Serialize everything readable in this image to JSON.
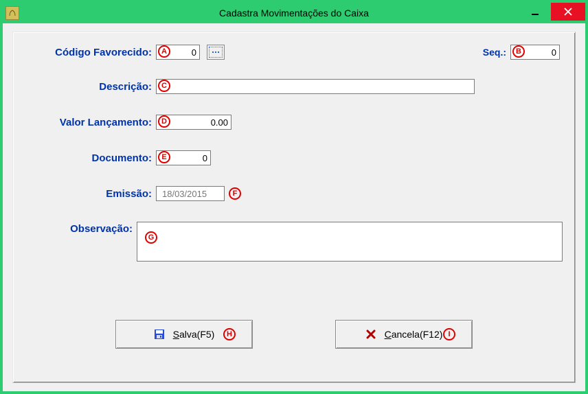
{
  "window": {
    "title": "Cadastra Movimentações do Caixa"
  },
  "labels": {
    "codigo_favorecido": "Código Favorecido:",
    "seq": "Seq.:",
    "descricao": "Descrição:",
    "valor_lancamento": "Valor Lançamento:",
    "documento": "Documento:",
    "emissao": "Emissão:",
    "observacao": "Observação:"
  },
  "values": {
    "codigo_favorecido": "0",
    "seq": "0",
    "descricao": "",
    "valor_lancamento": "0.00",
    "documento": "0",
    "emissao": "18/03/2015",
    "observacao": ""
  },
  "buttons": {
    "salva": "Salva(F5)",
    "cancela": "Cancela(F12)"
  },
  "markers": {
    "a": "A",
    "b": "B",
    "c": "C",
    "d": "D",
    "e": "E",
    "f": "F",
    "g": "G",
    "h": "H",
    "i": "I"
  }
}
